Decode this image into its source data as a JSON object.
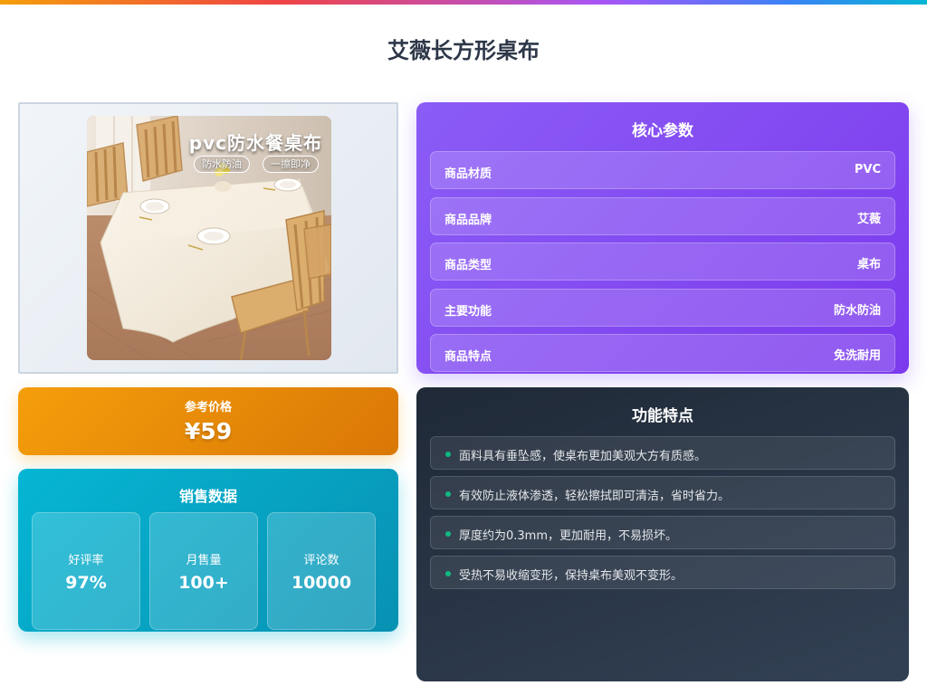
{
  "page": {
    "title": "艾薇长方形桌布"
  },
  "product_image": {
    "alt": "pvc防水餐桌布",
    "overlay_title": "pvc防水餐桌布",
    "tags": [
      "防水防油",
      "一擦即净"
    ]
  },
  "price": {
    "label": "参考价格",
    "value": "¥59"
  },
  "sales": {
    "title": "销售数据",
    "stats": [
      {
        "label": "好评率",
        "value": "97%"
      },
      {
        "label": "月售量",
        "value": "100+"
      },
      {
        "label": "评论数",
        "value": "10000"
      }
    ]
  },
  "specs": {
    "title": "核心参数",
    "rows": [
      {
        "label": "商品材质",
        "value": "PVC"
      },
      {
        "label": "商品品牌",
        "value": "艾薇"
      },
      {
        "label": "商品类型",
        "value": "桌布"
      },
      {
        "label": "主要功能",
        "value": "防水防油"
      },
      {
        "label": "商品特点",
        "value": "免洗耐用"
      }
    ]
  },
  "features": {
    "title": "功能特点",
    "items": [
      "面料具有垂坠感，使桌布更加美观大方有质感。",
      "有效防止液体渗透，轻松擦拭即可清洁，省时省力。",
      "厚度约为0.3mm，更加耐用，不易损坏。",
      "受热不易收缩变形，保持桌布美观不变形。"
    ]
  },
  "colors": {
    "price_gradient": [
      "#f59e0b",
      "#d97706"
    ],
    "sales_gradient": [
      "#06b6d4",
      "#0891b2"
    ],
    "specs_gradient": [
      "#8b5cf6",
      "#7c3aed"
    ],
    "features_bg": [
      "#1f2937",
      "#334155"
    ],
    "bullet": "#10b981"
  }
}
